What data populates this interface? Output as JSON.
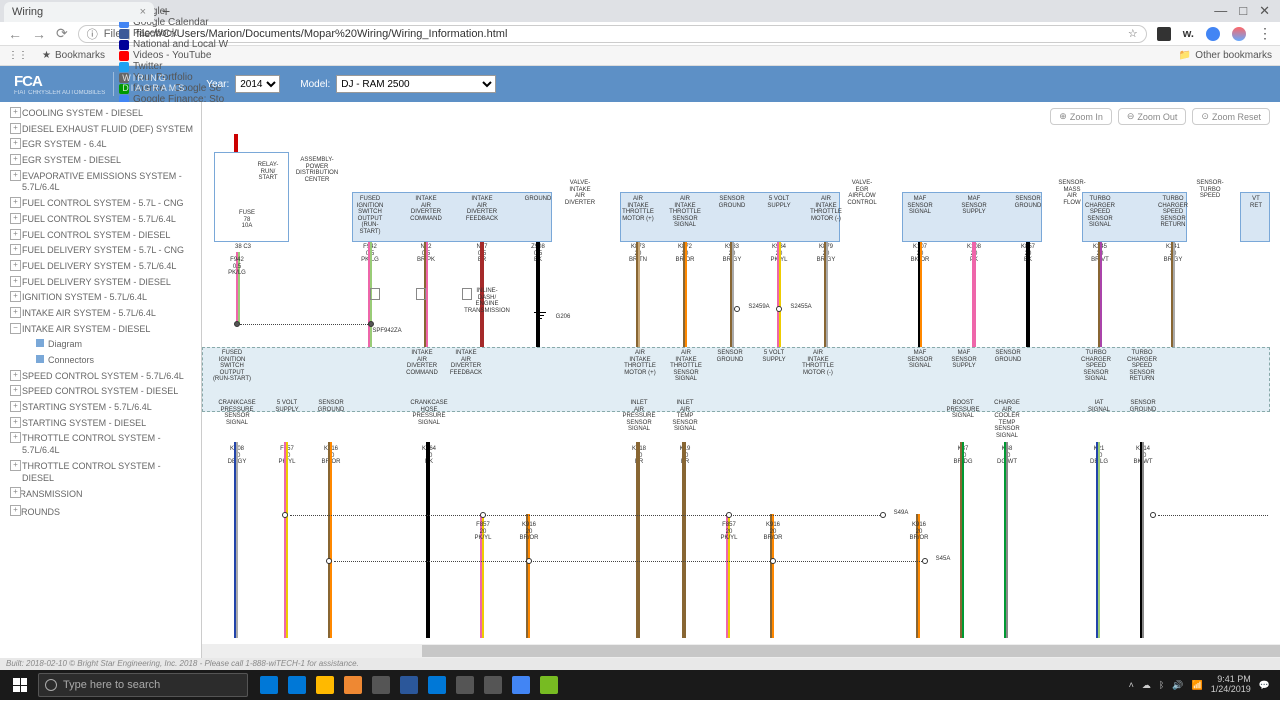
{
  "browser": {
    "tab_title": "Wiring",
    "url_prefix": "File",
    "url": "file:///C:/Users/Marion/Documents/Mopar%20Wiring/Wiring_Information.html",
    "controls": {
      "min": "—",
      "max": "□",
      "close": "✕"
    },
    "bookmarks_label": "Bookmarks",
    "other_bookmarks": "Other bookmarks",
    "bookmarks": [
      {
        "label": "Google",
        "color": "#4285f4"
      },
      {
        "label": "Google Calendar",
        "color": "#4285f4"
      },
      {
        "label": "Facebook",
        "color": "#3b5998"
      },
      {
        "label": "National and Local W",
        "color": "#009"
      },
      {
        "label": "Videos - YouTube",
        "color": "#f00"
      },
      {
        "label": "Twitter",
        "color": "#1da1f2"
      },
      {
        "label": "Your Portfolio",
        "color": "#666"
      },
      {
        "label": "finance - Google Se",
        "color": "#090"
      },
      {
        "label": "Google Finance: Sto",
        "color": "#4285f4"
      }
    ]
  },
  "app": {
    "brand": "FCA",
    "brand_sub": "FIAT CHRYSLER AUTOMOBILES",
    "product_line1": "WIRING",
    "product_line2": "DIAGRAMS",
    "year_label": "Year:",
    "year_value": "2014",
    "model_label": "Model:",
    "model_value": "DJ - RAM 2500",
    "zoom_in": "Zoom In",
    "zoom_out": "Zoom Out",
    "zoom_reset": "Zoom Reset"
  },
  "sidebar": {
    "items": [
      "COOLING SYSTEM - DIESEL",
      "DIESEL EXHAUST FLUID (DEF) SYSTEM",
      "EGR SYSTEM - 6.4L",
      "EGR SYSTEM - DIESEL",
      "EVAPORATIVE EMISSIONS SYSTEM - 5.7L/6.4L",
      "FUEL CONTROL SYSTEM - 5.7L - CNG",
      "FUEL CONTROL SYSTEM - 5.7L/6.4L",
      "FUEL CONTROL SYSTEM - DIESEL",
      "FUEL DELIVERY SYSTEM - 5.7L - CNG",
      "FUEL DELIVERY SYSTEM - 5.7L/6.4L",
      "FUEL DELIVERY SYSTEM - DIESEL",
      "IGNITION SYSTEM - 5.7L/6.4L",
      "INTAKE AIR SYSTEM - 5.7L/6.4L"
    ],
    "expanded": "INTAKE AIR SYSTEM - DIESEL",
    "expanded_children": [
      {
        "label": "Diagram",
        "icon": true
      },
      {
        "label": "Connectors",
        "icon": true
      }
    ],
    "items_after": [
      "SPEED CONTROL SYSTEM - 5.7L/6.4L",
      "SPEED CONTROL SYSTEM - DIESEL",
      "STARTING SYSTEM - 5.7L/6.4L",
      "STARTING SYSTEM - DIESEL",
      "THROTTLE CONTROL SYSTEM - 5.7L/6.4L",
      "THROTTLE CONTROL SYSTEM - DIESEL"
    ],
    "cats": [
      "TRANSMISSION",
      "GROUNDS"
    ]
  },
  "diagram": {
    "asm_box": "ASSEMBLY-\nPOWER\nDISTRIBUTION\nCENTER",
    "relay_label": "RELAY-\nRUN/\nSTART",
    "fuse_label": "FUSE\n78\n10A",
    "fuse_pin": "38   C3",
    "valve_intake": "VALVE-\nINTAKE\nAIR\nDIVERTER",
    "valve_egr": "VALVE-\nEGR\nAIRFLOW\nCONTROL",
    "sensor_maf": "SENSOR-\nMASS\nAIR\nFLOW",
    "sensor_turbo": "SENSOR-\nTURBO\nSPEED",
    "vt_ret": "VT\nRET",
    "inline": "INLINE-\nDASH/\nENGINE\nTRANSMISSION",
    "spf": "SPF942ZA",
    "g206": "G206",
    "s2459a": "S2459A",
    "s2455a": "S2455A",
    "s49a": "S49A",
    "s45a": "S45A",
    "conn1": [
      {
        "lbl": "FUSED\nIGNITION\nSWITCH\nOUTPUT\n(RUN-START)",
        "pin": "4",
        "id": "F942\n0.5\nPK/LG",
        "w": [
          "#e6a",
          "#9c7"
        ]
      },
      {
        "lbl": "INTAKE\nAIR\nDIVERTER\nCOMMAND",
        "pin": "3",
        "id": "N32\n0.5\nBR/PK",
        "w": [
          "#863",
          "#e6a"
        ]
      },
      {
        "lbl": "INTAKE\nAIR\nDIVERTER\nFEEDBACK",
        "pin": "2",
        "id": "N37\n0.5\nBR",
        "w": [
          "#a52a2a",
          "#a52a2a"
        ]
      },
      {
        "lbl": "GROUND",
        "pin": "1",
        "id": "Z908\n0.5\nBK",
        "w": [
          "#000",
          "#000"
        ]
      }
    ],
    "conn2": [
      {
        "lbl": "AIR\nINTAKE\nTHROTTLE\nMOTOR (+)",
        "pin": "",
        "id": "K873\n20\nBR/TN",
        "w": [
          "#863",
          "#c8a878"
        ]
      },
      {
        "lbl": "AIR\nINTAKE\nTHROTTLE\nSENSOR\nSIGNAL",
        "pin": "",
        "id": "K872\n20\nBR/OR",
        "w": [
          "#863",
          "#f80"
        ]
      },
      {
        "lbl": "SENSOR\nGROUND",
        "pin": "",
        "id": "K933\n20\nBR/GY",
        "w": [
          "#863",
          "#aaa"
        ]
      },
      {
        "lbl": "5 VOLT\nSUPPLY",
        "pin": "",
        "id": "K934\n20\nPK/YL",
        "w": [
          "#e6a",
          "#ec0"
        ]
      },
      {
        "lbl": "AIR\nINTAKE\nTHROTTLE\nMOTOR (-)",
        "pin": "",
        "id": "K879\n20\nBR/GY",
        "w": [
          "#863",
          "#aaa"
        ]
      }
    ],
    "conn3": [
      {
        "lbl": "MAF\nSENSOR\nSIGNAL",
        "pin": "",
        "id": "K107\n20\nBK/OR",
        "w": [
          "#000",
          "#f80"
        ]
      },
      {
        "lbl": "MAF\nSENSOR\nSUPPLY",
        "pin": "",
        "id": "K108\n20\nPK",
        "w": [
          "#e6a",
          "#e6a"
        ]
      },
      {
        "lbl": "SENSOR\nGROUND",
        "pin": "",
        "id": "K857\n20\nBK",
        "w": [
          "#000",
          "#000"
        ]
      }
    ],
    "conn4": [
      {
        "lbl": "TURBO\nCHARGER\nSPEED\nSENSOR\nSIGNAL",
        "pin": "",
        "id": "K345\n20\nBR/VT",
        "w": [
          "#863",
          "#a4a"
        ]
      },
      {
        "lbl": "TURBO\nCHARGER\nSPEED\nSENSOR\nRETURN",
        "pin": "",
        "id": "K341\n20\nBR/GY",
        "w": [
          "#863",
          "#aaa"
        ]
      }
    ],
    "band_upper": [
      "FUSED\nIGNITION\nSWITCH\nOUTPUT\n(RUN-START)",
      "INTAKE\nAIR\nDIVERTER\nCOMMAND",
      "INTAKE\nAIR\nDIVERTER\nFEEDBACK",
      "AIR\nINTAKE\nTHROTTLE\nMOTOR (+)",
      "AIR\nINTAKE\nTHROTTLE\nSENSOR\nSIGNAL",
      "SENSOR\nGROUND",
      "5 VOLT\nSUPPLY",
      "AIR\nINTAKE\nTHROTTLE\nMOTOR (-)",
      "MAF\nSENSOR\nSIGNAL",
      "MAF\nSENSOR\nSUPPLY",
      "SENSOR\nGROUND",
      "TURBO\nCHARGER\nSPEED\nSENSOR\nSIGNAL",
      "TURBO\nCHARGER\nSPEED\nSENSOR\nRETURN"
    ],
    "lower": [
      {
        "lbl": "CRANKCASE\nPRESSURE\nSENSOR\nSIGNAL",
        "id": "K808\n20\nDB/GY",
        "w": [
          "#24a",
          "#aaa"
        ]
      },
      {
        "lbl": "5 VOLT\nSUPPLY",
        "id": "F857\n20\nPK/YL",
        "w": [
          "#e6a",
          "#ec0"
        ]
      },
      {
        "lbl": "SENSOR\nGROUND",
        "id": "K916\n20\nBR/OR",
        "w": [
          "#863",
          "#f80"
        ]
      },
      {
        "lbl": "CRANKCASE\nHOSE\nPRESSURE\nSIGNAL",
        "id": "K864\n20\nBK",
        "w": [
          "#000",
          "#000"
        ]
      },
      {
        "lbl": "INLET\nAIR\nPRESSURE\nSENSOR\nSIGNAL",
        "id": "K918\n20\nBR",
        "w": [
          "#863",
          "#863"
        ]
      },
      {
        "lbl": "INLET\nAIR\nTEMP\nSENSOR\nSIGNAL",
        "id": "K19\n20\nBR",
        "w": [
          "#863",
          "#863"
        ]
      },
      {
        "lbl": "BOOST\nPRESSURE\nSIGNAL",
        "id": "K37\n20\nBR/DG",
        "w": [
          "#863",
          "#093"
        ]
      },
      {
        "lbl": "CHARGE\nAIR\nCOOLER\nTEMP\nSENSOR\nSIGNAL",
        "id": "K48\n20\nDG/WT",
        "w": [
          "#093",
          "#fff"
        ]
      },
      {
        "lbl": "IAT\nSIGNAL",
        "id": "K21\n20\nDB/LG",
        "w": [
          "#24a",
          "#9c7"
        ]
      },
      {
        "lbl": "SENSOR\nGROUND",
        "id": "K914\n20\nBK/WT",
        "w": [
          "#000",
          "#fff"
        ]
      }
    ],
    "lower_spl": [
      {
        "id": "F857\n20\nPK/YL",
        "w": [
          "#e6a",
          "#ec0"
        ]
      },
      {
        "id": "K916\n20\nBR/OR",
        "w": [
          "#863",
          "#f80"
        ]
      },
      {
        "id": "F857\n20\nPK/YL",
        "w": [
          "#e6a",
          "#ec0"
        ]
      },
      {
        "id": "K916\n20\nBR/OR",
        "w": [
          "#863",
          "#f80"
        ]
      },
      {
        "id": "K916\n20\nBR/OR",
        "w": [
          "#863",
          "#f80"
        ]
      }
    ]
  },
  "footer": "Built: 2018-02-10 © Bright Star Engineering, Inc. 2018 - Please call 1-888-wiTECH-1 for assistance.",
  "taskbar": {
    "search_placeholder": "Type here to search",
    "time": "9:41 PM",
    "date": "1/24/2019"
  }
}
